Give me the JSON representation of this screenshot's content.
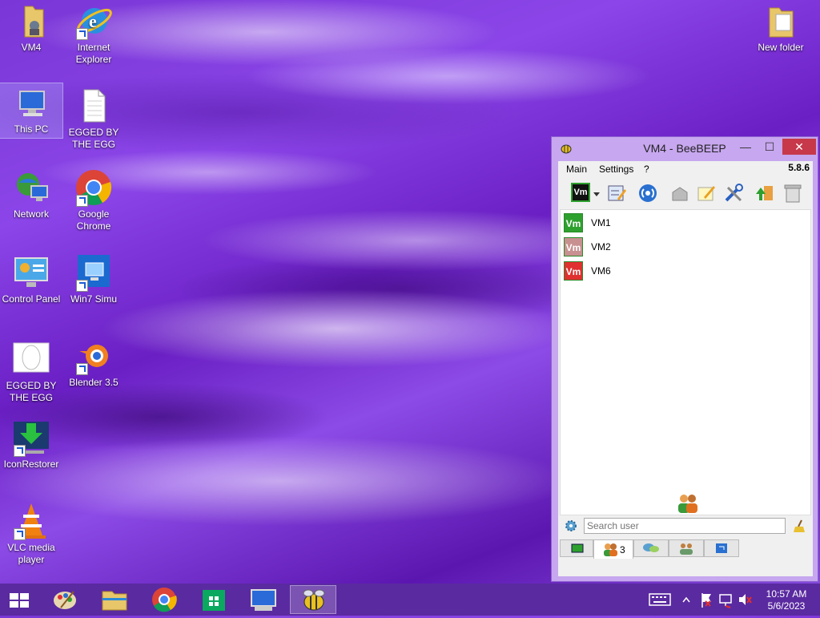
{
  "desktop": {
    "icons": [
      {
        "label": "VM4"
      },
      {
        "label": "Internet Explorer"
      },
      {
        "label": "This PC"
      },
      {
        "label": "EGGED BY THE EGG"
      },
      {
        "label": "Network"
      },
      {
        "label": "Google Chrome"
      },
      {
        "label": "Control Panel"
      },
      {
        "label": "Win7 Simu"
      },
      {
        "label": "EGGED BY THE EGG"
      },
      {
        "label": "Blender 3.5"
      },
      {
        "label": "IconRestorer"
      },
      {
        "label": "VLC media player"
      },
      {
        "label": "New folder"
      }
    ]
  },
  "beebeep": {
    "title": "VM4 - BeeBEEP",
    "menu": [
      "Main",
      "Settings",
      "?"
    ],
    "version": "5.8.6",
    "status_avatar_text": "Vm",
    "users": [
      {
        "avatar": "Vm",
        "name": "VM1",
        "color": "#2ea02e"
      },
      {
        "avatar": "Vm",
        "name": "VM2",
        "color": "#c89090"
      },
      {
        "avatar": "Vm",
        "name": "VM6",
        "color": "#e03030"
      }
    ],
    "search_placeholder": "Search user",
    "user_count": "3"
  },
  "taskbar": {
    "clock_time": "10:57 AM",
    "clock_date": "5/6/2023"
  },
  "colors": {
    "taskbar": "#5a2aa0",
    "window_frame": "#c7a7ef",
    "close_button": "#c7384a"
  }
}
